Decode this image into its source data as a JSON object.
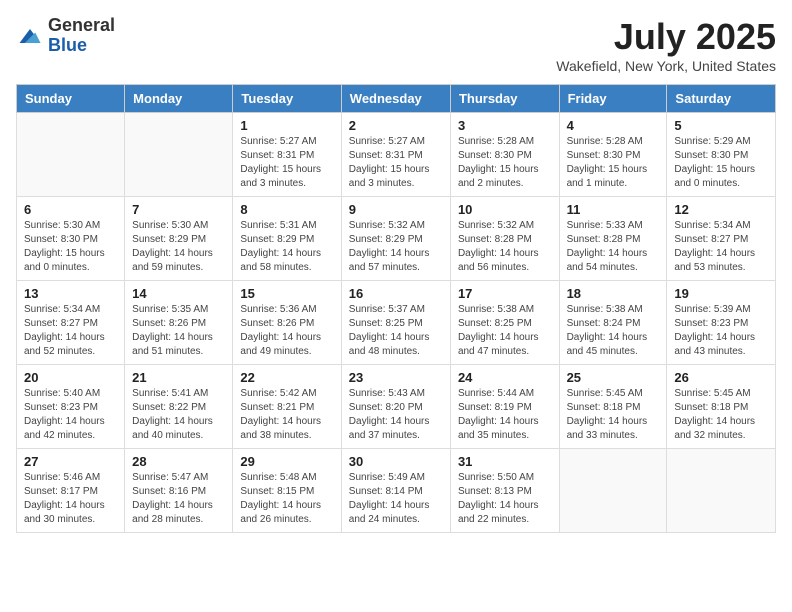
{
  "header": {
    "logo_general": "General",
    "logo_blue": "Blue",
    "month_title": "July 2025",
    "location": "Wakefield, New York, United States"
  },
  "days_of_week": [
    "Sunday",
    "Monday",
    "Tuesday",
    "Wednesday",
    "Thursday",
    "Friday",
    "Saturday"
  ],
  "weeks": [
    [
      {
        "day": "",
        "sunrise": "",
        "sunset": "",
        "daylight": ""
      },
      {
        "day": "",
        "sunrise": "",
        "sunset": "",
        "daylight": ""
      },
      {
        "day": "1",
        "sunrise": "Sunrise: 5:27 AM",
        "sunset": "Sunset: 8:31 PM",
        "daylight": "Daylight: 15 hours and 3 minutes."
      },
      {
        "day": "2",
        "sunrise": "Sunrise: 5:27 AM",
        "sunset": "Sunset: 8:31 PM",
        "daylight": "Daylight: 15 hours and 3 minutes."
      },
      {
        "day": "3",
        "sunrise": "Sunrise: 5:28 AM",
        "sunset": "Sunset: 8:30 PM",
        "daylight": "Daylight: 15 hours and 2 minutes."
      },
      {
        "day": "4",
        "sunrise": "Sunrise: 5:28 AM",
        "sunset": "Sunset: 8:30 PM",
        "daylight": "Daylight: 15 hours and 1 minute."
      },
      {
        "day": "5",
        "sunrise": "Sunrise: 5:29 AM",
        "sunset": "Sunset: 8:30 PM",
        "daylight": "Daylight: 15 hours and 0 minutes."
      }
    ],
    [
      {
        "day": "6",
        "sunrise": "Sunrise: 5:30 AM",
        "sunset": "Sunset: 8:30 PM",
        "daylight": "Daylight: 15 hours and 0 minutes."
      },
      {
        "day": "7",
        "sunrise": "Sunrise: 5:30 AM",
        "sunset": "Sunset: 8:29 PM",
        "daylight": "Daylight: 14 hours and 59 minutes."
      },
      {
        "day": "8",
        "sunrise": "Sunrise: 5:31 AM",
        "sunset": "Sunset: 8:29 PM",
        "daylight": "Daylight: 14 hours and 58 minutes."
      },
      {
        "day": "9",
        "sunrise": "Sunrise: 5:32 AM",
        "sunset": "Sunset: 8:29 PM",
        "daylight": "Daylight: 14 hours and 57 minutes."
      },
      {
        "day": "10",
        "sunrise": "Sunrise: 5:32 AM",
        "sunset": "Sunset: 8:28 PM",
        "daylight": "Daylight: 14 hours and 56 minutes."
      },
      {
        "day": "11",
        "sunrise": "Sunrise: 5:33 AM",
        "sunset": "Sunset: 8:28 PM",
        "daylight": "Daylight: 14 hours and 54 minutes."
      },
      {
        "day": "12",
        "sunrise": "Sunrise: 5:34 AM",
        "sunset": "Sunset: 8:27 PM",
        "daylight": "Daylight: 14 hours and 53 minutes."
      }
    ],
    [
      {
        "day": "13",
        "sunrise": "Sunrise: 5:34 AM",
        "sunset": "Sunset: 8:27 PM",
        "daylight": "Daylight: 14 hours and 52 minutes."
      },
      {
        "day": "14",
        "sunrise": "Sunrise: 5:35 AM",
        "sunset": "Sunset: 8:26 PM",
        "daylight": "Daylight: 14 hours and 51 minutes."
      },
      {
        "day": "15",
        "sunrise": "Sunrise: 5:36 AM",
        "sunset": "Sunset: 8:26 PM",
        "daylight": "Daylight: 14 hours and 49 minutes."
      },
      {
        "day": "16",
        "sunrise": "Sunrise: 5:37 AM",
        "sunset": "Sunset: 8:25 PM",
        "daylight": "Daylight: 14 hours and 48 minutes."
      },
      {
        "day": "17",
        "sunrise": "Sunrise: 5:38 AM",
        "sunset": "Sunset: 8:25 PM",
        "daylight": "Daylight: 14 hours and 47 minutes."
      },
      {
        "day": "18",
        "sunrise": "Sunrise: 5:38 AM",
        "sunset": "Sunset: 8:24 PM",
        "daylight": "Daylight: 14 hours and 45 minutes."
      },
      {
        "day": "19",
        "sunrise": "Sunrise: 5:39 AM",
        "sunset": "Sunset: 8:23 PM",
        "daylight": "Daylight: 14 hours and 43 minutes."
      }
    ],
    [
      {
        "day": "20",
        "sunrise": "Sunrise: 5:40 AM",
        "sunset": "Sunset: 8:23 PM",
        "daylight": "Daylight: 14 hours and 42 minutes."
      },
      {
        "day": "21",
        "sunrise": "Sunrise: 5:41 AM",
        "sunset": "Sunset: 8:22 PM",
        "daylight": "Daylight: 14 hours and 40 minutes."
      },
      {
        "day": "22",
        "sunrise": "Sunrise: 5:42 AM",
        "sunset": "Sunset: 8:21 PM",
        "daylight": "Daylight: 14 hours and 38 minutes."
      },
      {
        "day": "23",
        "sunrise": "Sunrise: 5:43 AM",
        "sunset": "Sunset: 8:20 PM",
        "daylight": "Daylight: 14 hours and 37 minutes."
      },
      {
        "day": "24",
        "sunrise": "Sunrise: 5:44 AM",
        "sunset": "Sunset: 8:19 PM",
        "daylight": "Daylight: 14 hours and 35 minutes."
      },
      {
        "day": "25",
        "sunrise": "Sunrise: 5:45 AM",
        "sunset": "Sunset: 8:18 PM",
        "daylight": "Daylight: 14 hours and 33 minutes."
      },
      {
        "day": "26",
        "sunrise": "Sunrise: 5:45 AM",
        "sunset": "Sunset: 8:18 PM",
        "daylight": "Daylight: 14 hours and 32 minutes."
      }
    ],
    [
      {
        "day": "27",
        "sunrise": "Sunrise: 5:46 AM",
        "sunset": "Sunset: 8:17 PM",
        "daylight": "Daylight: 14 hours and 30 minutes."
      },
      {
        "day": "28",
        "sunrise": "Sunrise: 5:47 AM",
        "sunset": "Sunset: 8:16 PM",
        "daylight": "Daylight: 14 hours and 28 minutes."
      },
      {
        "day": "29",
        "sunrise": "Sunrise: 5:48 AM",
        "sunset": "Sunset: 8:15 PM",
        "daylight": "Daylight: 14 hours and 26 minutes."
      },
      {
        "day": "30",
        "sunrise": "Sunrise: 5:49 AM",
        "sunset": "Sunset: 8:14 PM",
        "daylight": "Daylight: 14 hours and 24 minutes."
      },
      {
        "day": "31",
        "sunrise": "Sunrise: 5:50 AM",
        "sunset": "Sunset: 8:13 PM",
        "daylight": "Daylight: 14 hours and 22 minutes."
      },
      {
        "day": "",
        "sunrise": "",
        "sunset": "",
        "daylight": ""
      },
      {
        "day": "",
        "sunrise": "",
        "sunset": "",
        "daylight": ""
      }
    ]
  ]
}
